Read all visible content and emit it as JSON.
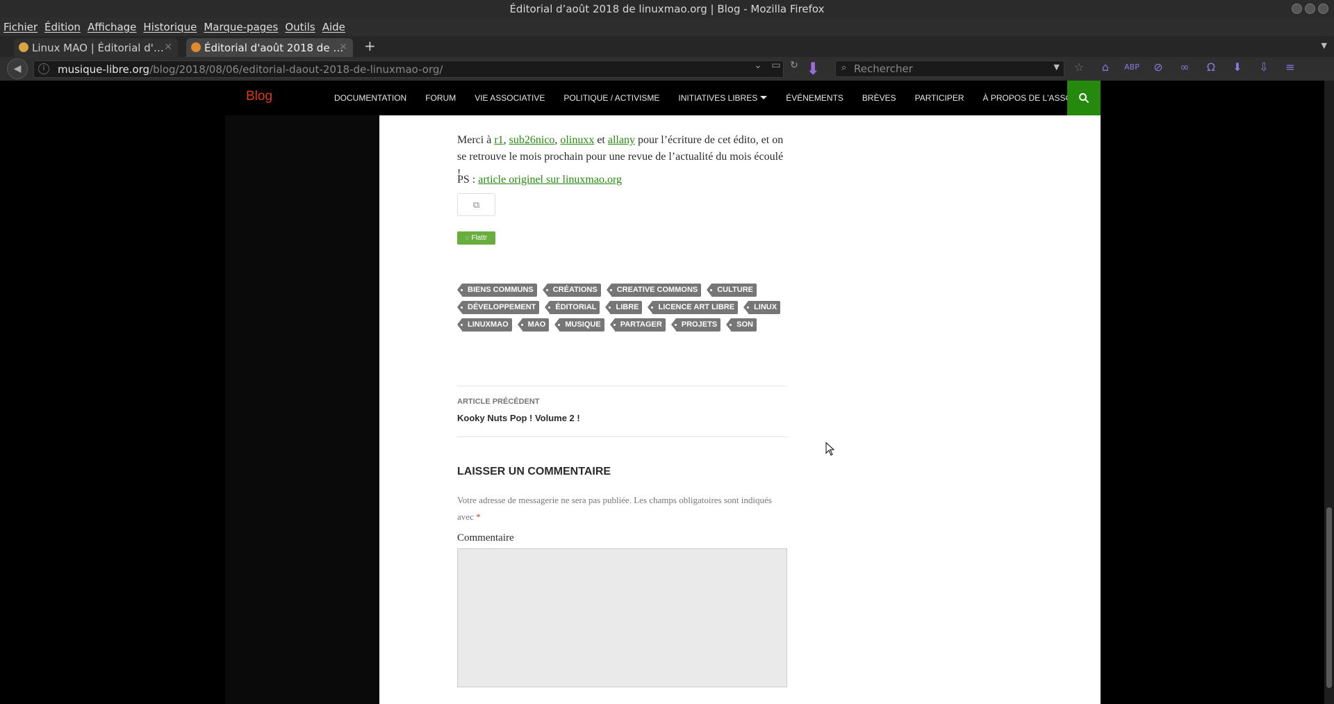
{
  "window": {
    "title": "Éditorial d’août 2018 de linuxmao.org | Blog - Mozilla Firefox"
  },
  "menubar": {
    "items": [
      "Fichier",
      "Édition",
      "Affichage",
      "Historique",
      "Marque-pages",
      "Outils",
      "Aide"
    ]
  },
  "tabs": [
    {
      "label": "Linux MAO | Éditorial d'…",
      "active": false
    },
    {
      "label": "Éditorial d'août 2018 de …",
      "active": true
    }
  ],
  "urlbar": {
    "host": "musique-libre.org",
    "path": "/blog/2018/08/06/editorial-daout-2018-de-linuxmao-org/"
  },
  "searchbar": {
    "placeholder": "Rechercher"
  },
  "site": {
    "title": "Blog",
    "nav": [
      {
        "label": "DOCUMENTATION",
        "dropdown": false
      },
      {
        "label": "FORUM",
        "dropdown": false
      },
      {
        "label": "VIE ASSOCIATIVE",
        "dropdown": false
      },
      {
        "label": "POLITIQUE / ACTIVISME",
        "dropdown": false
      },
      {
        "label": "INITIATIVES LIBRES",
        "dropdown": true
      },
      {
        "label": "ÉVÉNEMENTS",
        "dropdown": false
      },
      {
        "label": "BRÈVES",
        "dropdown": false
      },
      {
        "label": "PARTICIPER",
        "dropdown": false
      },
      {
        "label": "À PROPOS DE L'ASSO",
        "dropdown": true
      }
    ],
    "accent_color": "#24890d"
  },
  "article": {
    "thanks_prefix": "Merci à ",
    "authors": [
      "r1",
      "sub26nico",
      "olinuxx",
      "allany"
    ],
    "sep_comma": ", ",
    "sep_and": " et ",
    "thanks_suffix": " pour l’écriture de cet édito, et on se retrouve le mois prochain pour une revue de l’actualité du mois écoulé !",
    "ps_prefix": "PS : ",
    "ps_link": "article originel sur linuxmao.org",
    "flattr_label": "Flattr",
    "tags": [
      "BIENS COMMUNS",
      "CRÉATIONS",
      "CREATIVE COMMONS",
      "CULTURE",
      "DÉVELOPPEMENT",
      "ÉDITORIAL",
      "LIBRE",
      "LICENCE ART LIBRE",
      "LINUX",
      "LINUXMAO",
      "MAO",
      "MUSIQUE",
      "PARTAGER",
      "PROJETS",
      "SON"
    ]
  },
  "post_nav": {
    "prev_label": "ARTICLE PRÉCÉDENT",
    "prev_title": "Kooky Nuts Pop ! Volume 2 !"
  },
  "comments": {
    "title": "LAISSER UN COMMENTAIRE",
    "notes": "Votre adresse de messagerie ne sera pas publiée. Les champs obligatoires sont indiqués avec",
    "required_mark": "*",
    "comment_label": "Commentaire"
  }
}
